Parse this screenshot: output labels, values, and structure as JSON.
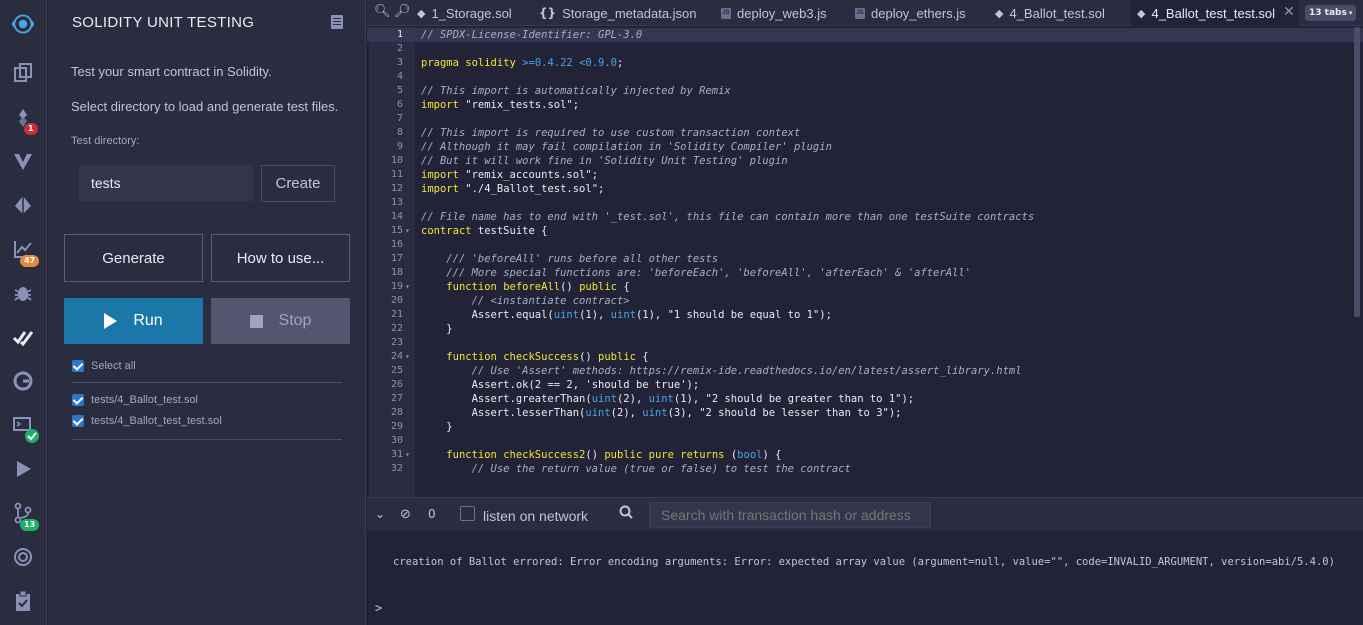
{
  "iconbar": {
    "items": [
      {
        "name": "remix-logo-icon",
        "badge": ""
      },
      {
        "name": "file-explorer-icon",
        "badge": ""
      },
      {
        "name": "solidity-compiler-icon",
        "badge": "1"
      },
      {
        "name": "vyper-icon",
        "badge": ""
      },
      {
        "name": "deploy-run-icon",
        "badge": ""
      },
      {
        "name": "analysis-chart-icon",
        "badge": "47"
      },
      {
        "name": "debugger-bug-icon",
        "badge": ""
      },
      {
        "name": "unit-testing-check-icon",
        "badge": ""
      },
      {
        "name": "plugin-g-icon",
        "badge": ""
      },
      {
        "name": "terminal-plugin-icon",
        "badge": ""
      },
      {
        "name": "play-plugin-icon",
        "badge": ""
      },
      {
        "name": "git-icon",
        "badge": "13"
      },
      {
        "name": "target-plugin-icon",
        "badge": ""
      },
      {
        "name": "clipboard-icon",
        "badge": ""
      }
    ],
    "badge_colors": {
      "red": "#c4313b",
      "orange": "#e7893b",
      "green": "#1eaf6a"
    }
  },
  "panel": {
    "title": "SOLIDITY UNIT TESTING",
    "intro": "Test your smart contract in Solidity.",
    "select_help": "Select directory to load and generate test files.",
    "test_dir_label": "Test directory:",
    "test_dir_value": "tests",
    "create_label": "Create",
    "generate_label": "Generate",
    "howto_label": "How to use...",
    "run_label": "Run",
    "stop_label": "Stop",
    "select_all_label": "Select all",
    "files": [
      "tests/4_Ballot_test.sol",
      "tests/4_Ballot_test_test.sol"
    ]
  },
  "tabs": [
    {
      "label": "1_Storage.sol",
      "kind": "sol"
    },
    {
      "label": "Storage_metadata.json",
      "kind": "json"
    },
    {
      "label": "deploy_web3.js",
      "kind": "js"
    },
    {
      "label": "deploy_ethers.js",
      "kind": "js"
    },
    {
      "label": "4_Ballot_test.sol",
      "kind": "sol"
    },
    {
      "label": "4_Ballot_test_test.sol",
      "kind": "sol",
      "active": true
    }
  ],
  "tabs_count": "13 tabs",
  "editor": {
    "lines": [
      "// SPDX-License-Identifier: GPL-3.0",
      "",
      "pragma solidity >=0.4.22 <0.9.0;",
      "",
      "// This import is automatically injected by Remix",
      "import \"remix_tests.sol\";",
      "",
      "// This import is required to use custom transaction context",
      "// Although it may fail compilation in 'Solidity Compiler' plugin",
      "// But it will work fine in 'Solidity Unit Testing' plugin",
      "import \"remix_accounts.sol\";",
      "import \"./4_Ballot_test.sol\";",
      "",
      "// File name has to end with '_test.sol', this file can contain more than one testSuite contracts",
      "contract testSuite {",
      "",
      "    /// 'beforeAll' runs before all other tests",
      "    /// More special functions are: 'beforeEach', 'beforeAll', 'afterEach' & 'afterAll'",
      "    function beforeAll() public {",
      "        // <instantiate contract>",
      "        Assert.equal(uint(1), uint(1), \"1 should be equal to 1\");",
      "    }",
      "",
      "    function checkSuccess() public {",
      "        // Use 'Assert' methods: https://remix-ide.readthedocs.io/en/latest/assert_library.html",
      "        Assert.ok(2 == 2, 'should be true');",
      "        Assert.greaterThan(uint(2), uint(1), \"2 should be greater than to 1\");",
      "        Assert.lesserThan(uint(2), uint(3), \"2 should be lesser than to 3\");",
      "    }",
      "",
      "    function checkSuccess2() public pure returns (bool) {",
      "        // Use the return value (true or false) to test the contract"
    ],
    "folds": [
      15,
      19,
      24,
      31
    ],
    "highlight_line": 1
  },
  "terminal": {
    "tx_count": "0",
    "listen_label": "listen on network",
    "search_placeholder": "Search with transaction hash or address",
    "message": "creation of Ballot errored: Error encoding arguments: Error: expected array value (argument=null, value=\"\", code=INVALID_ARGUMENT, version=abi/5.4.0)",
    "prompt": ">"
  }
}
